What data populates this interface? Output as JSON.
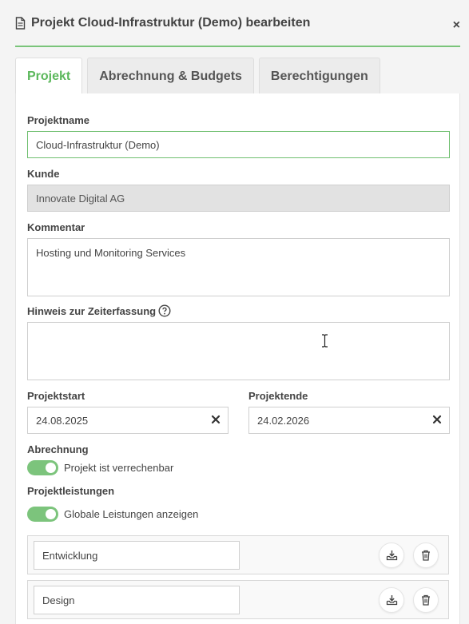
{
  "dialog": {
    "title": "Projekt Cloud-Infrastruktur (Demo) bearbeiten",
    "close_label": "×"
  },
  "tabs": [
    {
      "label": "Projekt",
      "active": true
    },
    {
      "label": "Abrechnung & Budgets",
      "active": false
    },
    {
      "label": "Berechtigungen",
      "active": false
    }
  ],
  "form": {
    "projektname_label": "Projektname",
    "projektname_value": "Cloud-Infrastruktur (Demo)",
    "kunde_label": "Kunde",
    "kunde_value": "Innovate Digital AG",
    "kommentar_label": "Kommentar",
    "kommentar_value": "Hosting und Monitoring Services",
    "hinweis_label": "Hinweis zur Zeiterfassung",
    "hinweis_value": "",
    "projektstart_label": "Projektstart",
    "projektstart_value": "24.08.2025",
    "projektende_label": "Projektende",
    "projektende_value": "24.02.2026",
    "abrechnung_label": "Abrechnung",
    "verrechenbar_label": "Projekt ist verrechenbar",
    "verrechenbar_on": true,
    "leistungen_label": "Projektleistungen",
    "globale_label": "Globale Leistungen anzeigen",
    "globale_on": true
  },
  "services": [
    {
      "name": "Entwicklung"
    },
    {
      "name": "Design"
    }
  ],
  "colors": {
    "accent": "#5cb85c",
    "toggle": "#7cc47c",
    "disabled_field": "#e2e2e2"
  },
  "icons": {
    "title": "document-icon",
    "help": "question-circle-icon",
    "clear": "x-icon",
    "import": "tray-download-icon",
    "delete": "trash-icon"
  }
}
